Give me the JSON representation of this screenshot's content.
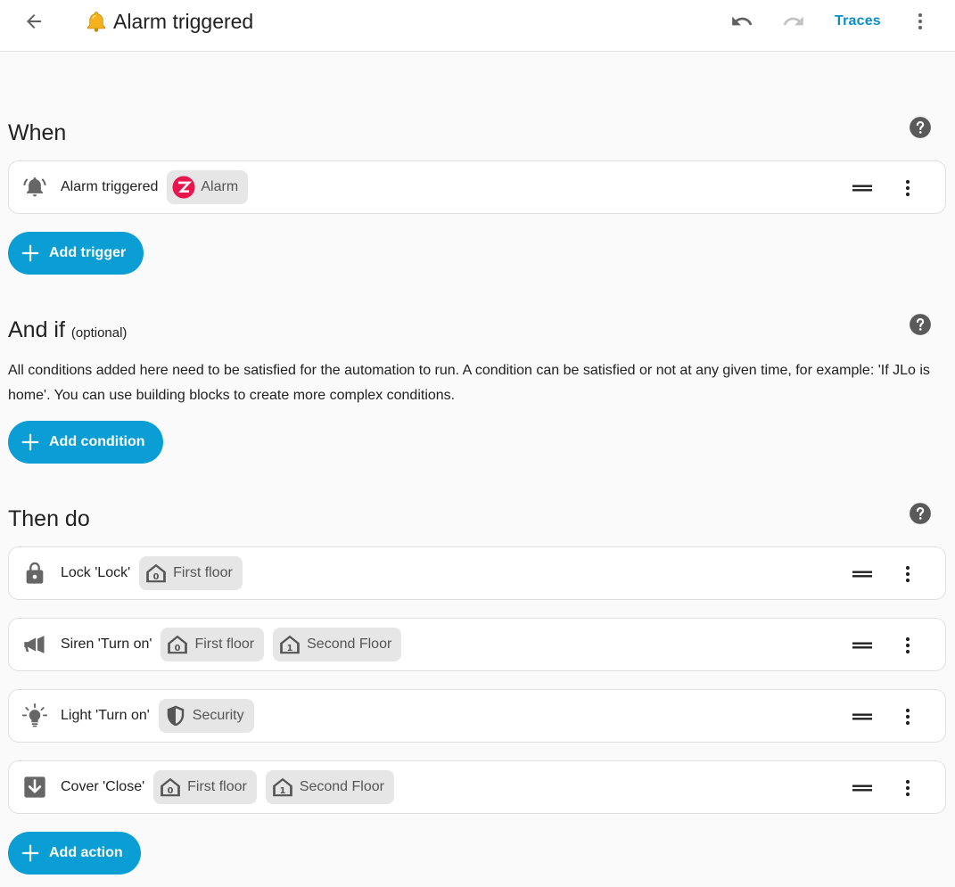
{
  "header": {
    "title": "Alarm triggered",
    "title_icon": "bell-emoji-icon",
    "traces_label": "Traces"
  },
  "colors": {
    "accent": "#0a9ed4",
    "traces_text": "#0a8fc4",
    "chip_bg": "#e6e6e6",
    "zha_red": "#e8154f"
  },
  "when": {
    "title": "When",
    "triggers": [
      {
        "icon": "bell-ring-icon",
        "label": "Alarm triggered",
        "chips": [
          {
            "icon": "zha-logo-icon",
            "label": "Alarm"
          }
        ]
      }
    ],
    "add_label": "Add trigger"
  },
  "and_if": {
    "title": "And if",
    "optional": "(optional)",
    "description": "All conditions added here need to be satisfied for the automation to run. A condition can be satisfied or not at any given time, for example: 'If JLo is home'. You can use building blocks to create more complex conditions.",
    "add_label": "Add condition"
  },
  "then_do": {
    "title": "Then do",
    "actions": [
      {
        "icon": "lock-icon",
        "label": "Lock 'Lock'",
        "chips": [
          {
            "icon": "floor-0-icon",
            "label": "First floor"
          }
        ]
      },
      {
        "icon": "bullhorn-icon",
        "label": "Siren 'Turn on'",
        "chips": [
          {
            "icon": "floor-0-icon",
            "label": "First floor"
          },
          {
            "icon": "floor-1-icon",
            "label": "Second Floor"
          }
        ]
      },
      {
        "icon": "lightbulb-icon",
        "label": "Light 'Turn on'",
        "chips": [
          {
            "icon": "shield-icon",
            "label": "Security"
          }
        ]
      },
      {
        "icon": "arrow-down-box-icon",
        "label": "Cover 'Close'",
        "chips": [
          {
            "icon": "floor-0-icon",
            "label": "First floor"
          },
          {
            "icon": "floor-1-icon",
            "label": "Second Floor"
          }
        ]
      }
    ],
    "add_label": "Add action"
  }
}
